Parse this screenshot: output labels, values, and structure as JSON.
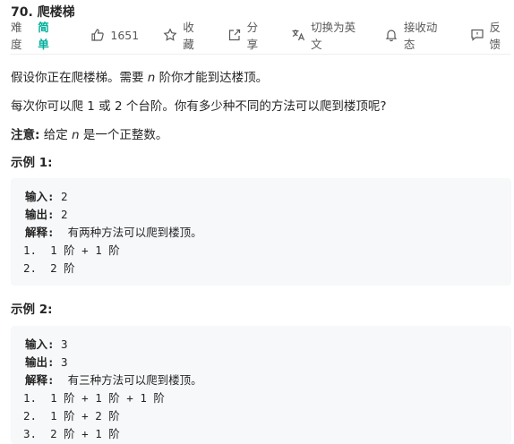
{
  "problem": {
    "title": "70. 爬楼梯",
    "difficulty_label": "难度",
    "difficulty_value": "简单",
    "likes": "1651",
    "favorite": "收藏",
    "share": "分享",
    "switch_lang": "切换为英文",
    "notifications": "接收动态",
    "feedback": "反馈"
  },
  "description": {
    "p1_prefix": "假设你正在爬楼梯。需要 ",
    "p1_var": "n",
    "p1_suffix": " 阶你才能到达楼顶。",
    "p2": "每次你可以爬 1 或 2 个台阶。你有多少种不同的方法可以爬到楼顶呢?",
    "note_label": "注意:",
    "note_prefix": " 给定 ",
    "note_var": "n",
    "note_suffix": " 是一个正整数。"
  },
  "examples": [
    {
      "title": "示例 1:",
      "input_label": "输入:",
      "input_value": " 2",
      "output_label": "输出:",
      "output_value": " 2",
      "explain_label": "解释:",
      "explain_value": "  有两种方法可以爬到楼顶。",
      "steps": [
        "1.  1 阶 + 1 阶",
        "2.  2 阶"
      ]
    },
    {
      "title": "示例 2:",
      "input_label": "输入:",
      "input_value": " 3",
      "output_label": "输出:",
      "output_value": " 3",
      "explain_label": "解释:",
      "explain_value": "  有三种方法可以爬到楼顶。",
      "steps": [
        "1.  1 阶 + 1 阶 + 1 阶",
        "2.  1 阶 + 2 阶",
        "3.  2 阶 + 1 阶"
      ]
    }
  ],
  "colors": {
    "easy": "#00af9b",
    "code_bg": "#f7f8fa",
    "meta_text": "#595959"
  }
}
